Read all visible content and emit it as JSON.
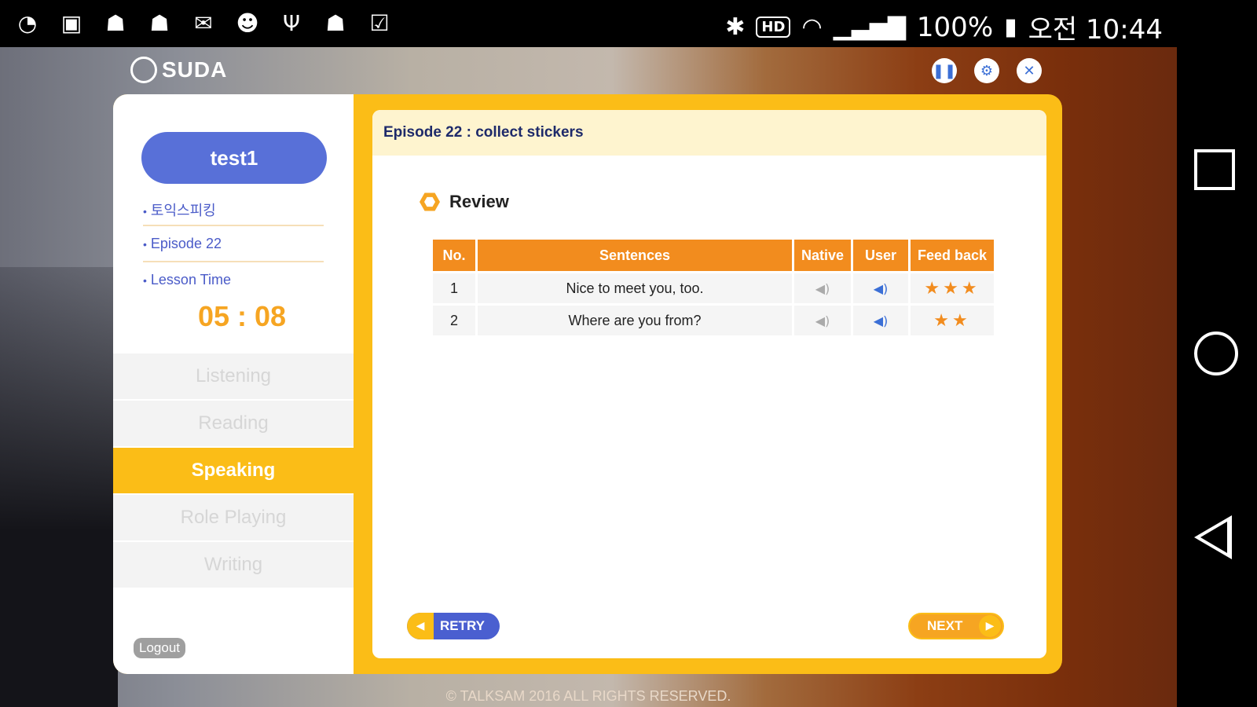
{
  "statusbar": {
    "left_icons": [
      "ring-icon",
      "image-icon",
      "robot-icon",
      "android-icon",
      "chat-icon",
      "game-icon",
      "usb-icon",
      "android-icon",
      "task-icon"
    ],
    "hd": "HD",
    "battery": "100%",
    "time": "오전 10:44"
  },
  "app": {
    "logo": "SUDA",
    "user": "test1",
    "course": "토익스피킹",
    "episode": "Episode 22",
    "lesson_time_label": "Lesson Time",
    "lesson_time": "05 : 08",
    "menu": [
      {
        "label": "Listening",
        "active": false
      },
      {
        "label": "Reading",
        "active": false
      },
      {
        "label": "Speaking",
        "active": true
      },
      {
        "label": "Role Playing",
        "active": false
      },
      {
        "label": "Writing",
        "active": false
      }
    ],
    "logout": "Logout"
  },
  "content": {
    "title": "Episode 22 : collect stickers",
    "section": "Review",
    "table": {
      "headers": [
        "No.",
        "Sentences",
        "Native",
        "User",
        "Feed back"
      ],
      "rows": [
        {
          "no": "1",
          "sentence": "Nice to meet you, too.",
          "stars": "★★★"
        },
        {
          "no": "2",
          "sentence": "Where are you from?",
          "stars": "★★"
        }
      ]
    },
    "retry": "RETRY",
    "next": "NEXT"
  },
  "footer": "© TALKSAM 2016 ALL RIGHTS RESERVED.",
  "colors": {
    "accent": "#fbbd17",
    "orange": "#f28c1e",
    "blue": "#5870d8"
  }
}
